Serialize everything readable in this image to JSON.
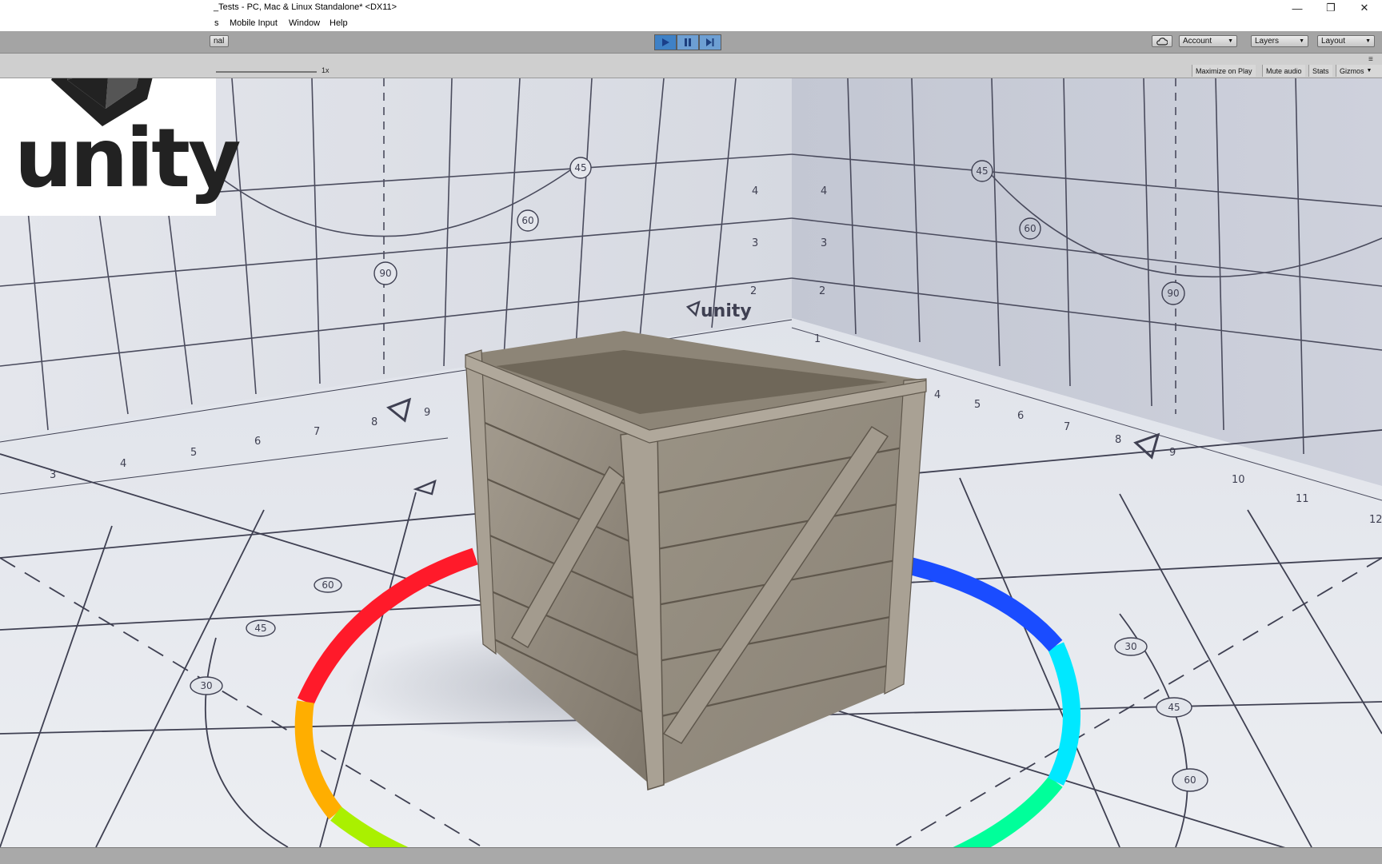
{
  "window": {
    "title": "_Tests - PC, Mac & Linux Standalone* <DX11>",
    "controls": [
      "minimize",
      "restore",
      "close"
    ]
  },
  "menu": {
    "items": [
      "s",
      "Mobile Input",
      "Window",
      "Help"
    ]
  },
  "toolbar": {
    "left_partial": "nal",
    "account_label": "Account",
    "layers_label": "Layers",
    "layout_label": "Layout",
    "cloud_icon": "cloud-icon",
    "play_controls": [
      "play-icon",
      "pause-icon",
      "step-icon"
    ],
    "play_active": true
  },
  "game_view": {
    "scale_label": "1x",
    "maximize_on_play": "Maximize on Play",
    "mute_audio": "Mute audio",
    "stats": "Stats",
    "gizmos": "Gizmos"
  },
  "logo": {
    "wordmark": "unity"
  },
  "scene": {
    "back_wall_logo": "unity",
    "left_wall_numbers": [
      "3",
      "4",
      "5",
      "6",
      "7",
      "8",
      "9"
    ],
    "left_wall_vertical": [
      "4",
      "3",
      "2"
    ],
    "left_wall_angles": [
      "45",
      "60",
      "90"
    ],
    "right_wall_numbers": [
      "4",
      "5",
      "6",
      "7",
      "8",
      "9",
      "10",
      "11",
      "12"
    ],
    "right_wall_vertical": [
      "4",
      "3",
      "2",
      "1"
    ],
    "right_wall_angles": [
      "45",
      "60",
      "90"
    ],
    "floor_angles_left": [
      "60",
      "45",
      "30"
    ],
    "floor_angles_right": [
      "30",
      "45",
      "60"
    ]
  },
  "colors": {
    "toolbar_bg": "#a4a4a4",
    "play_active": "#3d83c9",
    "crate": "#8f8678",
    "grid_line": "#3f4052"
  }
}
